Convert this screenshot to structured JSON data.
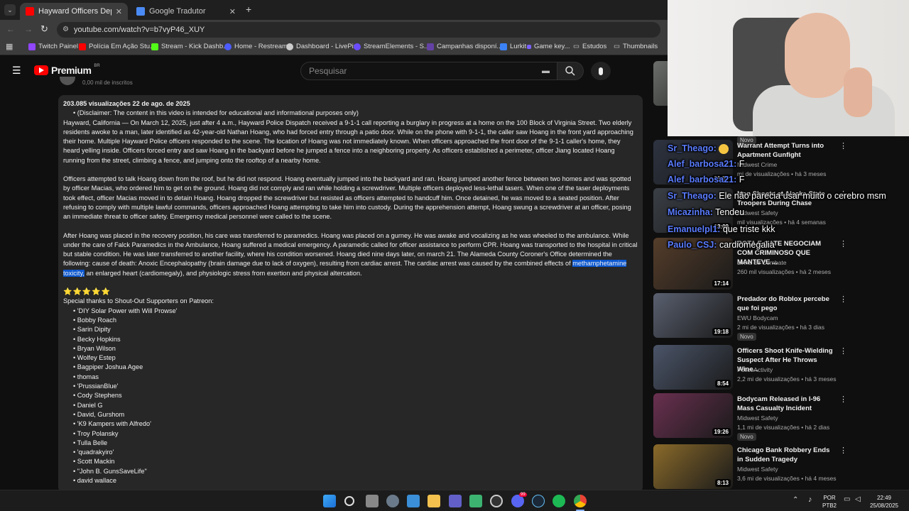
{
  "browser": {
    "tabs": [
      {
        "label": "Hayward Officers Deploy Taser",
        "active": true
      },
      {
        "label": "Google Tradutor",
        "active": false
      }
    ],
    "url": "youtube.com/watch?v=b7vyP46_XUY",
    "bookmarks": [
      "Twitch Painel",
      "Polícia Em Ação Stu...",
      "Stream - Kick Dashb...",
      "Home - Restream",
      "Dashboard - LivePix",
      "StreamElements - S...",
      "Campanhas disponí...",
      "Lurkit",
      "Game key...",
      "Estudos",
      "Thumbnails"
    ]
  },
  "youtube": {
    "logo": "Premium",
    "region": "BR",
    "search_placeholder": "Pesquisar",
    "subscriber_line": "0,00 mil de inscritos"
  },
  "description": {
    "stats": "203.085 visualizações  22 de ago. de 2025",
    "disclaimer": "(Disclaimer: The content in this video is intended for educational and informational purposes only)",
    "p1": "Hayward, California — On March 12, 2025, just after 4 a.m., Hayward Police Dispatch received a 9-1-1 call reporting a burglary in progress at a home on the 100 Block of Virginia Street. Two elderly residents awoke to a man, later identified as 42-year-old Nathan Hoang, who had forced entry through a patio door. While on the phone with 9-1-1, the caller saw Hoang in the front yard approaching their home. Multiple Hayward Police officers responded to the scene. The location of Hoang was not immediately known. When officers approached the front door of the 9-1-1 caller's home, they heard yelling inside. Officers forced entry and saw Hoang in the backyard before he jumped a fence into a neighboring property. As officers established a perimeter, officer Jiang located Hoang running from the street, climbing a fence, and jumping onto the rooftop of a nearby home.",
    "p2": "Officers attempted to talk Hoang down from the roof, but he did not respond. Hoang eventually jumped into the backyard and ran. Hoang jumped another fence between two homes and was spotted by officer Macias, who ordered him to get on the ground. Hoang did not comply and ran while holding a screwdriver. Multiple officers deployed less-lethal tasers. When one of the taser deployments took effect, officer Macias moved in to detain Hoang. Hoang dropped the screwdriver but resisted as officers attempted to handcuff him. Once detained, he was moved to a seated position. After refusing to comply with multiple lawful commands, officers approached Hoang attempting to take him into custody. During the apprehension attempt, Hoang swung a screwdriver at an officer, posing an immediate threat to officer safety. Emergency medical personnel were called to the scene.",
    "p3_before": "After Hoang was placed in the recovery position, his care was transferred to paramedics. Hoang was placed on a gurney. He was awake and vocalizing as he was wheeled to the ambulance. While under the care of Falck Paramedics in the Ambulance, Hoang suffered a medical emergency. A paramedic called for officer assistance to perform CPR. Hoang was transported to the hospital in critical but stable condition. He was later transferred to another facility, where his condition worsened. Hoang died nine days later, on march 21. The Alameda County Coroner's Office determined the following: cause of death: Anoxic Encephalopathy (brain damage due to lack of oxygen), resulting from cardiac arrest. The cardiac arrest was caused by the combined effects of ",
    "p3_highlight": "methamphetamine toxicity,",
    "p3_after": " an enlarged heart (cardiomegaly), and physiologic stress from exertion and physical altercation.",
    "stars": "⭐⭐⭐⭐⭐",
    "thanks": "Special thanks to Shout-Out Supporters on Patreon:",
    "supporters": [
      "'DIY Solar Power with Will Prowse'",
      "Bobby Roach",
      "Sarin Dipity",
      "Becky Hopkins",
      "Bryan Wilson",
      "Wolfey Estep",
      "Bagpiper Joshua Agee",
      "thomas",
      "'PrussianBlue'",
      "Cody Stephens",
      "Daniel G",
      "David, Gurshom",
      "'K9 Kampers with Alfredo'",
      "Troy Polansky",
      "Tulla Belle",
      "'quadrakyiro'",
      "Scott Mackin",
      "\"John B. GunsSaveLife\"",
      "david wallace"
    ]
  },
  "sidebar": [
    {
      "title": "",
      "channel": "",
      "meta": "",
      "duration": "",
      "new": "Novo",
      "thumb_color": "#6b6e6a"
    },
    {
      "title": "Warrant Attempt Turns into Apartment Gunfight",
      "channel": "Midwest Crime",
      "meta": "mi de visualizações • há 3 meses",
      "duration": "21:57",
      "thumb_color": "#2d3340"
    },
    {
      "title": "Man Shoots at Alaska State Troopers During Chase",
      "channel": "Midwest Safety",
      "meta": "mil visualizações • há 4 semanas",
      "duration": "13:09",
      "thumb_color": "#3a3f46"
    },
    {
      "title": "ROTA E GATE NEGOCIAM COM CRIMINOSO QUE MANTEVE ...",
      "channel": "Linha de Combate",
      "meta": "260 mil visualizações • há 2 meses",
      "duration": "17:14",
      "thumb_color": "#553d2a"
    },
    {
      "title": "Predador do Roblox percebe que foi pego",
      "channel": "EWU Bodycam",
      "meta": "2 mi de visualizações • há 3 dias",
      "duration": "19:18",
      "new": "Novo",
      "thumb_color": "#5a6070"
    },
    {
      "title": "Officers Shoot Knife-Wielding Suspect After He Throws Wine...",
      "channel": "PoliceActivity",
      "meta": "2,2 mi de visualizações • há 3 meses",
      "duration": "8:54",
      "thumb_color": "#4b5569"
    },
    {
      "title": "Bodycam Released in I-96 Mass Casualty Incident",
      "channel": "Midwest Safety",
      "meta": "1,1 mi de visualizações • há 2 dias",
      "duration": "19:26",
      "new": "Novo",
      "thumb_color": "#6a3050"
    },
    {
      "title": "Chicago Bank Robbery Ends in Sudden Tragedy",
      "channel": "Midwest Safety",
      "meta": "3,6 mi de visualizações • há 4 meses",
      "duration": "8:13",
      "thumb_color": "#8a6a2a"
    }
  ],
  "chat": [
    {
      "user": "Sr_Theago:",
      "msg": "",
      "emote": true
    },
    {
      "user": "Alef_barbosa21:",
      "msg": "F"
    },
    {
      "user": "Alef_barbosa21:",
      "msg": "F"
    },
    {
      "user": "Sr_Theago:",
      "msg": "Ele não parecia usar muito o cerebro msm"
    },
    {
      "user": "Micazinha:",
      "msg": "Tendeu"
    },
    {
      "user": "Emanuelpl1:",
      "msg": "que triste kkk"
    },
    {
      "user": "Paulo_CSJ:",
      "msg": "cardiomegalia"
    }
  ],
  "taskbar": {
    "lang": "POR",
    "kb": "PTB2",
    "time": "22:49",
    "date": "25/08/2025",
    "badge": "99"
  },
  "colors": {
    "highlight": "#0b57d0",
    "youtube_red": "#ff0000",
    "chat_user": "#5a7cff"
  }
}
